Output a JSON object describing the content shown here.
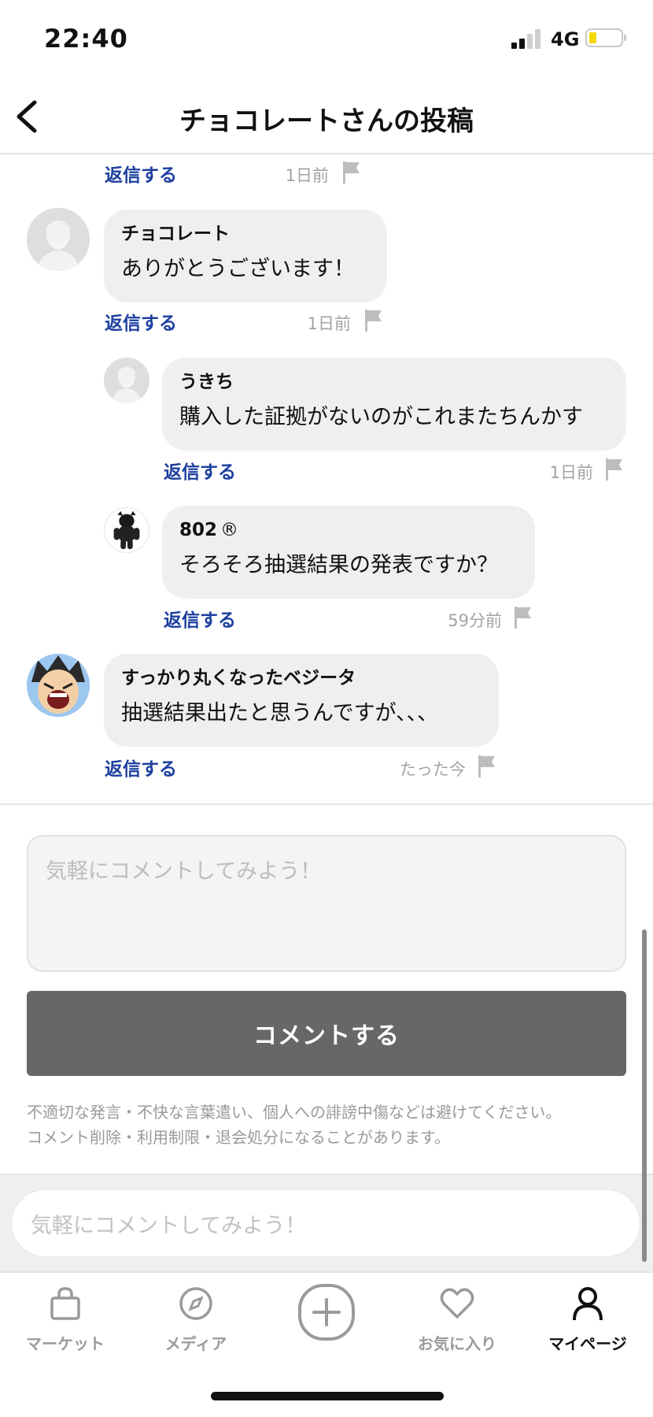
{
  "status_bar": {
    "time": "22:40",
    "network": "4G"
  },
  "header": {
    "title": "チョコレートさんの投稿"
  },
  "comments": [
    {
      "reply_label": "返信する",
      "time": "1日前"
    },
    {
      "name": "チョコレート",
      "text": "ありがとうございます！",
      "reply_label": "返信する",
      "time": "1日前"
    },
    {
      "name": "うきち",
      "text": "購入した証拠がないのがこれまたちんかす",
      "reply_label": "返信する",
      "time": "1日前"
    },
    {
      "name": "802",
      "name_mark": "®",
      "text": "そろそろ抽選結果の発表ですか？",
      "reply_label": "返信する",
      "time": "59分前"
    },
    {
      "name": "すっかり丸くなったベジータ",
      "text": "抽選結果出たと思うんですが、、、",
      "reply_label": "返信する",
      "time": "たった今"
    }
  ],
  "comment_form": {
    "placeholder": "気軽にコメントしてみよう！",
    "submit_label": "コメントする",
    "notice_line1": "不適切な発言・不快な言葉遣い、個人への誹謗中傷などは避けてください。",
    "notice_line2": "コメント削除・利用制限・退会処分になることがあります。"
  },
  "bottom_input": {
    "placeholder": "気軽にコメントしてみよう！"
  },
  "tab_bar": {
    "items": [
      {
        "label": "マーケット",
        "icon": "shopping-bag-icon"
      },
      {
        "label": "メディア",
        "icon": "compass-icon"
      },
      {
        "label": "",
        "icon": "plus-circle-icon"
      },
      {
        "label": "お気に入り",
        "icon": "heart-icon"
      },
      {
        "label": "マイページ",
        "icon": "person-icon"
      }
    ],
    "active": "マイページ"
  },
  "colors": {
    "reply": "#1d3fa0",
    "bubble": "#efefef",
    "submit": "#676767",
    "battery": "#f5d800"
  }
}
